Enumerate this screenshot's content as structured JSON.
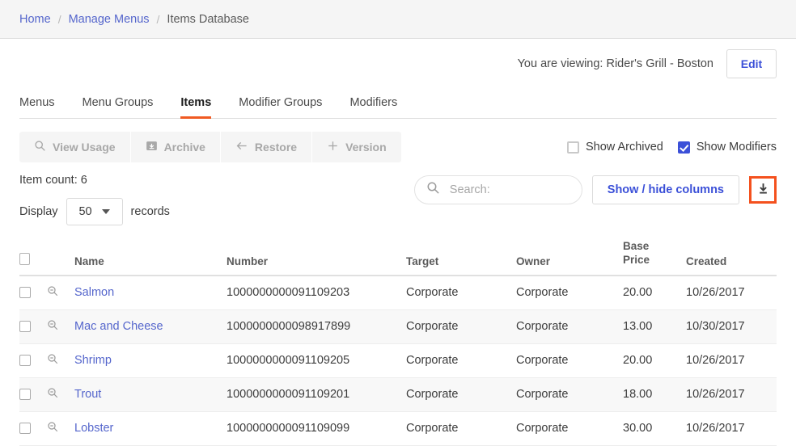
{
  "breadcrumb": {
    "items": [
      {
        "label": "Home",
        "current": false
      },
      {
        "label": "Manage Menus",
        "current": false
      },
      {
        "label": "Items Database",
        "current": true
      }
    ],
    "separator": "/"
  },
  "header": {
    "viewing_text": "You are viewing: Rider's Grill - Boston",
    "edit_label": "Edit"
  },
  "tabs": [
    {
      "label": "Menus",
      "active": false
    },
    {
      "label": "Menu Groups",
      "active": false
    },
    {
      "label": "Items",
      "active": true
    },
    {
      "label": "Modifier Groups",
      "active": false
    },
    {
      "label": "Modifiers",
      "active": false
    }
  ],
  "toolbar": {
    "buttons": [
      {
        "label": "View Usage",
        "icon": "magnifier-icon"
      },
      {
        "label": "Archive",
        "icon": "archive-box-icon"
      },
      {
        "label": "Restore",
        "icon": "arrow-left-icon"
      },
      {
        "label": "Version",
        "icon": "plus-icon"
      }
    ],
    "checkboxes": [
      {
        "label": "Show Archived",
        "checked": false
      },
      {
        "label": "Show Modifiers",
        "checked": true
      }
    ]
  },
  "controls": {
    "item_count": "Item count: 6",
    "display_label": "Display",
    "records_label": "records",
    "page_size": "50",
    "search_placeholder": "Search:",
    "search_value": "",
    "columns_label": "Show / hide columns",
    "download_icon": "download-icon"
  },
  "table": {
    "columns": [
      "Name",
      "Number",
      "Target",
      "Owner",
      "Base Price",
      "Created"
    ],
    "price_header_line1": "Base",
    "price_header_line2": "Price",
    "rows": [
      {
        "name": "Salmon",
        "number": "1000000000091109203",
        "target": "Corporate",
        "owner": "Corporate",
        "price": "20.00",
        "created": "10/26/2017"
      },
      {
        "name": "Mac and Cheese",
        "number": "1000000000098917899",
        "target": "Corporate",
        "owner": "Corporate",
        "price": "13.00",
        "created": "10/30/2017"
      },
      {
        "name": "Shrimp",
        "number": "1000000000091109205",
        "target": "Corporate",
        "owner": "Corporate",
        "price": "20.00",
        "created": "10/26/2017"
      },
      {
        "name": "Trout",
        "number": "1000000000091109201",
        "target": "Corporate",
        "owner": "Corporate",
        "price": "18.00",
        "created": "10/26/2017"
      },
      {
        "name": "Lobster",
        "number": "1000000000091109099",
        "target": "Corporate",
        "owner": "Corporate",
        "price": "30.00",
        "created": "10/26/2017"
      }
    ]
  },
  "colors": {
    "link": "#5566cc",
    "accent_blue": "#3b50d8",
    "active_tab_underline": "#f05a22",
    "highlight_border": "#f4511e"
  }
}
